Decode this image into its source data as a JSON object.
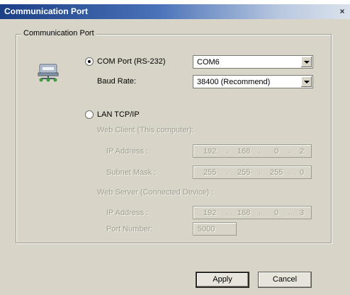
{
  "window": {
    "title": "Communication Port",
    "close_label": "×"
  },
  "group": {
    "legend": "Communication Port"
  },
  "com": {
    "radio_label": "COM Port (RS-232)",
    "port_value": "COM6",
    "baud_label": "Baud Rate:",
    "baud_value": "38400 (Recommend)"
  },
  "lan": {
    "radio_label": "LAN TCP/IP",
    "web_client_label": "Web Client (This computer):",
    "client_ip_label": "IP Address :",
    "client_ip": [
      "192",
      "168",
      "0",
      "2"
    ],
    "subnet_label": "Subnet Mask :",
    "subnet": [
      "255",
      "255",
      "255",
      "0"
    ],
    "web_server_label": "Web Server (Connected Device) :",
    "server_ip_label": "IP Address :",
    "server_ip": [
      "192",
      "168",
      "0",
      "3"
    ],
    "port_label": "Port Number:",
    "port_value": "5000"
  },
  "buttons": {
    "apply": "Apply",
    "cancel": "Cancel"
  },
  "icons": {
    "network": "network-computer-icon"
  }
}
